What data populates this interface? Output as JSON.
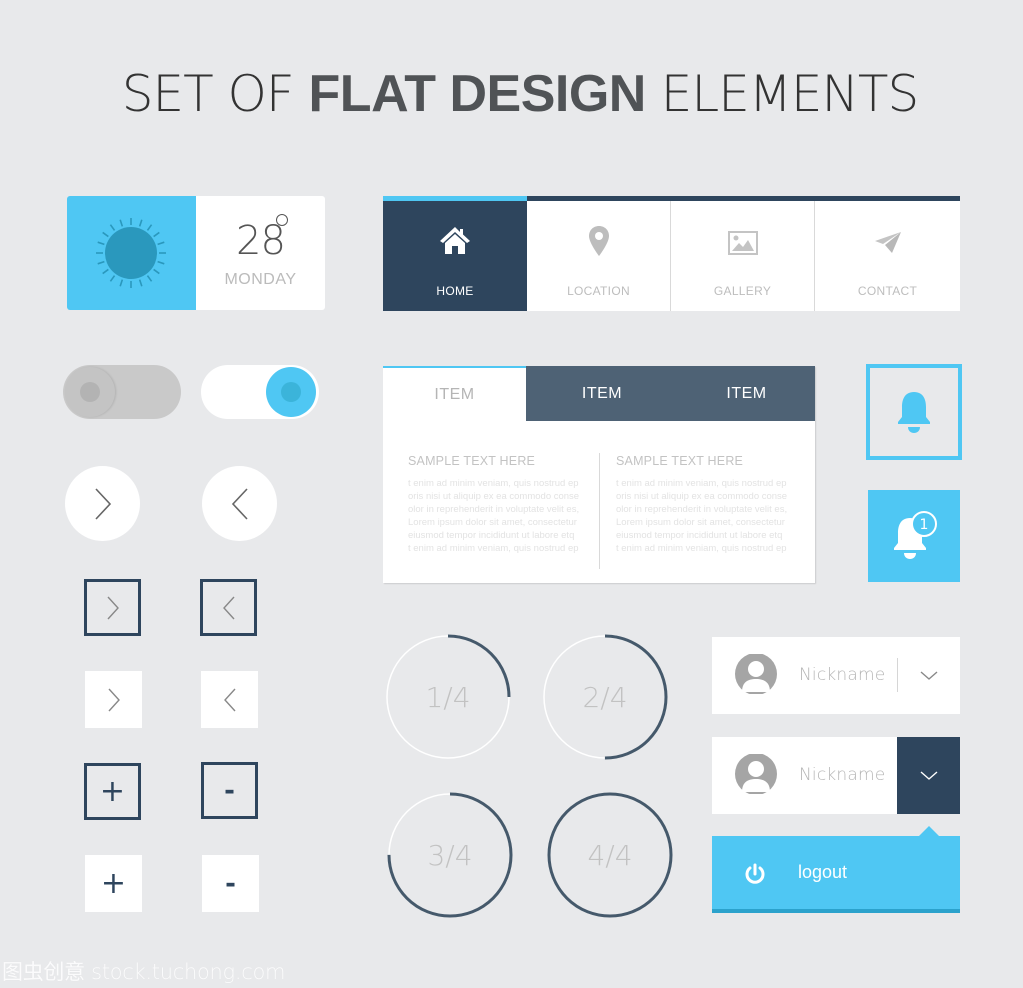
{
  "title": {
    "part1": "SET OF ",
    "part2": "FLAT DESIGN",
    "part3": " ELEMENTS"
  },
  "weather": {
    "icon": "sun-icon",
    "temperature": "28",
    "day": "MONDAY"
  },
  "nav": {
    "items": [
      {
        "label": "HOME",
        "icon": "home-icon",
        "active": true
      },
      {
        "label": "LOCATION",
        "icon": "map-pin-icon",
        "active": false
      },
      {
        "label": "GALLERY",
        "icon": "image-icon",
        "active": false
      },
      {
        "label": "CONTACT",
        "icon": "paper-plane-icon",
        "active": false
      }
    ]
  },
  "toggles": [
    {
      "state": "off"
    },
    {
      "state": "on"
    }
  ],
  "arrows": {
    "next": ">",
    "prev": "<"
  },
  "stepper": {
    "plus": "+",
    "minus": "-"
  },
  "tabs": {
    "items": [
      {
        "label": "ITEM",
        "active": true
      },
      {
        "label": "ITEM",
        "active": false
      },
      {
        "label": "ITEM",
        "active": false
      }
    ],
    "columns": [
      {
        "title": "SAMPLE TEXT HERE",
        "lines": [
          "t enim ad minim veniam, quis nostrud ep",
          "oris nisi ut aliquip ex ea commodo conse",
          "olor in reprehenderit in voluptate velit es,",
          "Lorem ipsum dolor sit amet, consectetur",
          "eiusmod tempor incididunt ut labore etq",
          "t enim ad minim veniam, quis nostrud ep"
        ]
      },
      {
        "title": "SAMPLE TEXT HERE",
        "lines": [
          "t enim ad minim veniam, quis nostrud ep",
          "oris nisi ut aliquip ex ea commodo conse",
          "olor in reprehenderit in voluptate velit es,",
          "Lorem ipsum dolor sit amet, consectetur",
          "eiusmod tempor incididunt ut labore etq",
          "t enim ad minim veniam, quis nostrud ep"
        ]
      }
    ]
  },
  "notifications": {
    "outline_icon": "bell-icon",
    "filled_icon": "bell-icon",
    "badge_count": "1"
  },
  "progress": [
    {
      "label": "1/4",
      "fraction": 0.25
    },
    {
      "label": "2/4",
      "fraction": 0.5
    },
    {
      "label": "3/4",
      "fraction": 0.75
    },
    {
      "label": "4/4",
      "fraction": 1.0
    }
  ],
  "user_menus": [
    {
      "name": "Nickname",
      "style": "light"
    },
    {
      "name": "Nickname",
      "style": "dark"
    }
  ],
  "logout": {
    "icon": "power-icon",
    "label": "logout"
  },
  "watermark": "图虫创意 stock.tuchong.com",
  "colors": {
    "accent": "#4fc7f3",
    "navy": "#2e455d",
    "slate": "#4e6275",
    "background": "#e8e9eb"
  }
}
